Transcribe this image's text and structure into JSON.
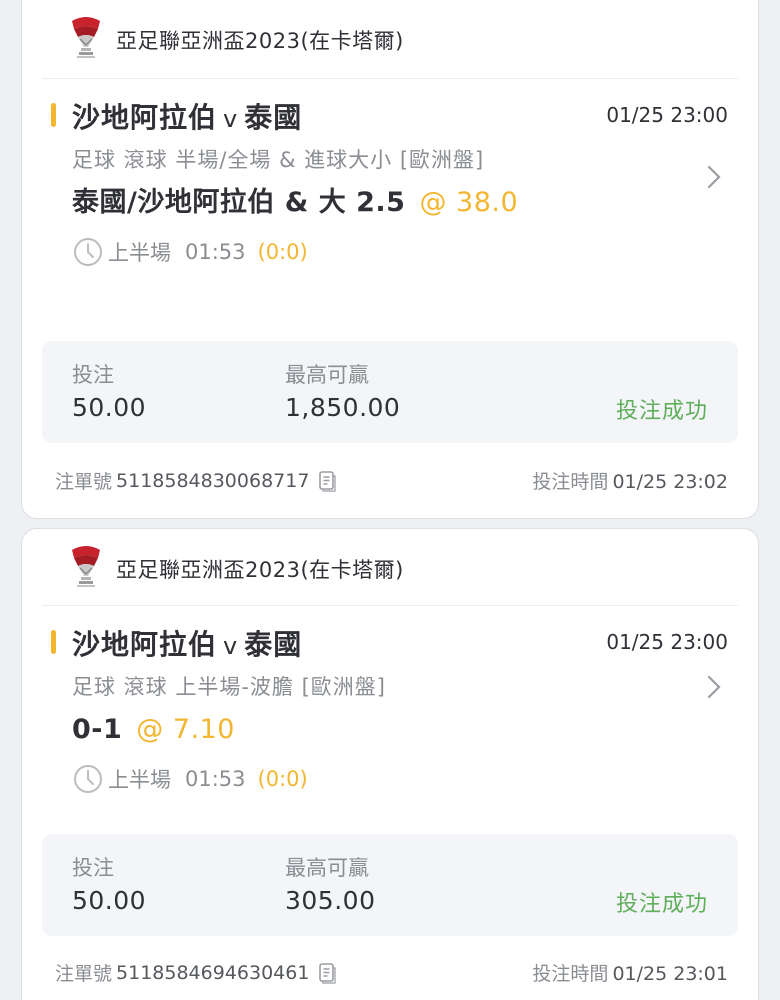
{
  "cards": [
    {
      "league": "亞足聯亞洲盃2023(在卡塔爾)",
      "home": "沙地阿拉伯",
      "vs": "v",
      "away": "泰國",
      "match_time": "01/25 23:00",
      "market": "足球  滾球   半場/全場 & 進球大小  [歐洲盤]",
      "selection": "泰國/沙地阿拉伯 & 大 2.5",
      "odds": "@ 38.0",
      "period": "上半場",
      "elapsed": "01:53",
      "score": "(0:0)",
      "stake_label": "投注",
      "stake": "50.00",
      "max_win_label": "最高可贏",
      "max_win": "1,850.00",
      "result": "投注成功",
      "ticket_label": "注單號",
      "ticket_no": "5118584830068717",
      "bet_time_label": "投注時間",
      "bet_time": "01/25 23:02"
    },
    {
      "league": "亞足聯亞洲盃2023(在卡塔爾)",
      "home": "沙地阿拉伯",
      "vs": "v",
      "away": "泰國",
      "match_time": "01/25 23:00",
      "market": "足球  滾球   上半場-波膽  [歐洲盤]",
      "selection": "0-1",
      "odds": "@ 7.10",
      "period": "上半場",
      "elapsed": "01:53",
      "score": "(0:0)",
      "stake_label": "投注",
      "stake": "50.00",
      "max_win_label": "最高可贏",
      "max_win": "305.00",
      "result": "投注成功",
      "ticket_label": "注單號",
      "ticket_no": "5118584694630461",
      "bet_time_label": "投注時間",
      "bet_time": "01/25 23:01"
    }
  ],
  "colors": {
    "accent": "#f2b630",
    "success": "#5fae5a",
    "muted": "#8a8d92"
  },
  "icons": {
    "logo": "afc-asian-cup-logo",
    "chevron": "chevron-right-icon",
    "clock": "clock-icon",
    "copy": "copy-icon"
  }
}
